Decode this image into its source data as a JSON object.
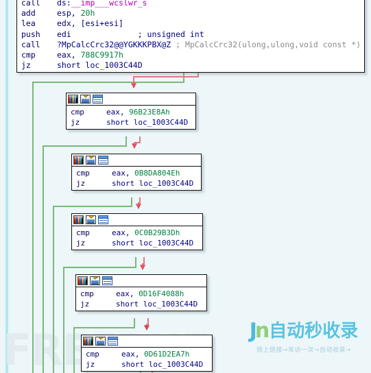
{
  "app": {
    "view": "IDA Pro graph view",
    "background_color": "#edf6f9",
    "node_border_color": "#101010",
    "edge_true_color": "#7ab87a",
    "edge_false_color": "#e07a82"
  },
  "watermarks": {
    "left": "FREEBUF",
    "right_logo": "Jn",
    "right_title": "自动秒收录",
    "right_sub": "微上链接→来访一次→自动收录→"
  },
  "node_icons": [
    {
      "name": "palette-icon",
      "label": "palette"
    },
    {
      "name": "edit-icon",
      "label": "edit"
    },
    {
      "name": "window-icon",
      "label": "window"
    }
  ],
  "nodes": [
    {
      "id": "root",
      "lines": [
        {
          "mnemonic": "call",
          "parts": [
            {
              "text": "ds:",
              "cls": "op-kw"
            },
            {
              "text": "__imp___wcslwr_s",
              "cls": "op-name"
            }
          ]
        },
        {
          "mnemonic": "add",
          "parts": [
            {
              "text": "esp, ",
              "cls": "op-reg"
            },
            {
              "text": "20h",
              "cls": "op-num"
            }
          ]
        },
        {
          "mnemonic": "lea",
          "parts": [
            {
              "text": "edx, [esi+esi]",
              "cls": "op-reg"
            }
          ]
        },
        {
          "mnemonic": "push",
          "parts": [
            {
              "text": "edi",
              "cls": "op-reg"
            },
            {
              "text": "              ; unsigned int",
              "cls": "op-kw"
            }
          ]
        },
        {
          "mnemonic": "call",
          "parts": [
            {
              "text": "?MpCalcCrc32@@YGKKKPBX@Z ",
              "cls": "op-fn"
            },
            {
              "text": "; MpCalcCrc32(ulong,ulong,void const *)",
              "cls": "op-cmt"
            }
          ]
        },
        {
          "mnemonic": "cmp",
          "parts": [
            {
              "text": "eax, ",
              "cls": "op-reg"
            },
            {
              "text": "788C9917h",
              "cls": "op-num"
            }
          ]
        },
        {
          "mnemonic": "jz",
          "parts": [
            {
              "text": "short ",
              "cls": "op-kw"
            },
            {
              "text": "loc_1003C44D",
              "cls": "op-loc"
            }
          ]
        }
      ]
    },
    {
      "id": "blk1",
      "lines": [
        {
          "mnemonic": "cmp",
          "parts": [
            {
              "text": "eax, ",
              "cls": "op-reg"
            },
            {
              "text": "96B23E8Ah",
              "cls": "op-num"
            }
          ]
        },
        {
          "mnemonic": "jz",
          "parts": [
            {
              "text": "short ",
              "cls": "op-kw"
            },
            {
              "text": "loc_1003C44D",
              "cls": "op-loc"
            }
          ]
        }
      ]
    },
    {
      "id": "blk2",
      "lines": [
        {
          "mnemonic": "cmp",
          "parts": [
            {
              "text": "eax, ",
              "cls": "op-reg"
            },
            {
              "text": "0B8DA804Eh",
              "cls": "op-num"
            }
          ]
        },
        {
          "mnemonic": "jz",
          "parts": [
            {
              "text": "short ",
              "cls": "op-kw"
            },
            {
              "text": "loc_1003C44D",
              "cls": "op-loc"
            }
          ]
        }
      ]
    },
    {
      "id": "blk3",
      "lines": [
        {
          "mnemonic": "cmp",
          "parts": [
            {
              "text": "eax, ",
              "cls": "op-reg"
            },
            {
              "text": "0C0B29B3Dh",
              "cls": "op-num"
            }
          ]
        },
        {
          "mnemonic": "jz",
          "parts": [
            {
              "text": "short ",
              "cls": "op-kw"
            },
            {
              "text": "loc_1003C44D",
              "cls": "op-loc"
            }
          ]
        }
      ]
    },
    {
      "id": "blk4",
      "lines": [
        {
          "mnemonic": "cmp",
          "parts": [
            {
              "text": "eax, ",
              "cls": "op-reg"
            },
            {
              "text": "0D16F4088h",
              "cls": "op-num"
            }
          ]
        },
        {
          "mnemonic": "jz",
          "parts": [
            {
              "text": "short ",
              "cls": "op-kw"
            },
            {
              "text": "loc_1003C44D",
              "cls": "op-loc"
            }
          ]
        }
      ]
    },
    {
      "id": "blk5",
      "lines": [
        {
          "mnemonic": "cmp",
          "parts": [
            {
              "text": "eax, ",
              "cls": "op-reg"
            },
            {
              "text": "0D61D2EA7h",
              "cls": "op-num"
            }
          ]
        },
        {
          "mnemonic": "jz",
          "parts": [
            {
              "text": "short ",
              "cls": "op-kw"
            },
            {
              "text": "loc_1003C44D",
              "cls": "op-loc"
            }
          ]
        }
      ]
    }
  ]
}
